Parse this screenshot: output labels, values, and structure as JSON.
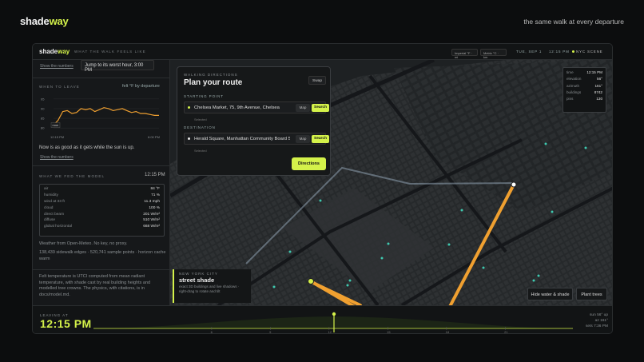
{
  "page": {
    "logo": {
      "part1": "shade",
      "part2": "way"
    },
    "tagline": "the same walk at every departure"
  },
  "header": {
    "logo": {
      "part1": "shade",
      "part2": "way"
    },
    "tagline": "WHAT THE WALK FEELS LIKE",
    "units": [
      {
        "label": "Imperial",
        "extra": "°F · mi"
      },
      {
        "label": "Metric",
        "extra": "°C · km"
      }
    ],
    "date": "TUE, SEP 1",
    "time": "12:15 PM",
    "scene": "NYC SCENE"
  },
  "sidebar": {
    "show_numbers": "Show the numbers",
    "worst_hour_button": "Jump to its worst hour, 3:00 PM",
    "when_to_leave": {
      "label": "WHEN TO LEAVE",
      "right_label": "felt °F by departure",
      "now_marker": "now",
      "x_start": "12:15 PM",
      "x_end": "6:00 PM",
      "note": "Now is as good as it gets while the sun is up."
    },
    "model": {
      "label": "WHAT WE FED THE MODEL",
      "time": "12:15 PM",
      "rows": [
        {
          "key": "air",
          "value": "84 °F"
        },
        {
          "key": "humidity",
          "value": "71 %"
        },
        {
          "key": "wind at 33 ft",
          "value": "11.3 mph"
        },
        {
          "key": "cloud",
          "value": "100 %"
        },
        {
          "key": "direct beam",
          "value": "201 W/m²"
        },
        {
          "key": "diffuse",
          "value": "510 W/m²"
        },
        {
          "key": "global horizontal",
          "value": "668 W/m²"
        }
      ],
      "source": "Weather from Open-Meteo. No key, no proxy.",
      "stats": "138,439 sidewalk edges · 520,741 sample points · horizon cache warm",
      "felt_note": "Felt temperature is UTCI computed from mean radiant temperature, with shade cast by real building heights and modelled tree crowns. The physics, with citations, is in docs/model.md."
    }
  },
  "chart_data": {
    "type": "line",
    "title": "",
    "ylabel": "felt °F by departure",
    "y_ticks": [
      "95",
      "90",
      "85",
      "80"
    ],
    "ylim": [
      78,
      97
    ],
    "x_labels": [
      "12:15 PM",
      "6:00 PM"
    ],
    "x": [
      "12:15",
      "12:30",
      "12:45",
      "1:00",
      "1:15",
      "1:30",
      "1:45",
      "2:00",
      "2:15",
      "2:30",
      "2:45",
      "3:00",
      "3:15",
      "3:30",
      "3:45",
      "4:00",
      "4:15",
      "4:30",
      "4:45",
      "5:00",
      "5:15",
      "5:30",
      "5:45",
      "6:00"
    ],
    "series": [
      {
        "values": [
          81.5,
          84,
          88.5,
          89,
          87.5,
          88,
          90,
          89.5,
          90,
          88.5,
          89.5,
          90.5,
          90,
          89,
          89.5,
          90,
          89,
          88,
          88.5,
          87.5,
          87.5,
          87,
          86.5,
          86.5
        ]
      }
    ]
  },
  "route": {
    "kicker": "WALKING DIRECTIONS",
    "title": "Plan your route",
    "swap": "Swap",
    "start_label": "STARTING POINT",
    "start_value": "Chelsea Market, 75, 9th Avenue, Chelsea",
    "dest_label": "DESTINATION",
    "dest_value": "Herald Square, Manhattan Community Board 5",
    "map_btn": "Map",
    "search_btn": "Search",
    "selected": "Selected",
    "directions": "Directions"
  },
  "info": [
    {
      "key": "time",
      "value": "12:15 PM"
    },
    {
      "key": "elevation",
      "value": "56°"
    },
    {
      "key": "azimuth",
      "value": "161°"
    },
    {
      "key": "buildings",
      "value": "8742"
    },
    {
      "key": "pins",
      "value": "130"
    }
  ],
  "shade_card": {
    "kicker": "NEW YORK CITY",
    "title": "street shade",
    "desc": "exact 3D buildings and live shadows · right-drag to rotate and tilt"
  },
  "map_buttons": {
    "hide_water": "Hide water & shade",
    "plant_trees": "Plant trees"
  },
  "timeline": {
    "label": "LEAVING AT",
    "time": "12:15 PM",
    "ticks": [
      "6",
      "9",
      "12",
      "15",
      "18",
      "21"
    ],
    "sun": [
      "sun 56° up",
      "az 161°",
      "sets 7:36 PM"
    ]
  },
  "colors": {
    "accent": "#d4f24a",
    "route": "#f0a030",
    "background": "#0c0d0e"
  }
}
